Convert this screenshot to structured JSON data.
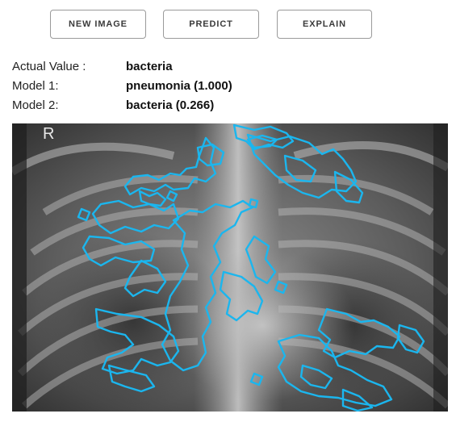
{
  "toolbar": {
    "new_image_label": "NEW IMAGE",
    "predict_label": "PREDICT",
    "explain_label": "EXPLAIN"
  },
  "results": {
    "actual": {
      "label": "Actual Value :",
      "value": "bacteria"
    },
    "model1": {
      "label": "Model 1:",
      "value": "pneumonia (1.000)"
    },
    "model2": {
      "label": "Model 2:",
      "value": "bacteria (0.266)"
    }
  },
  "xray": {
    "side_marker": "R",
    "overlay_color": "#1bb6ee"
  }
}
